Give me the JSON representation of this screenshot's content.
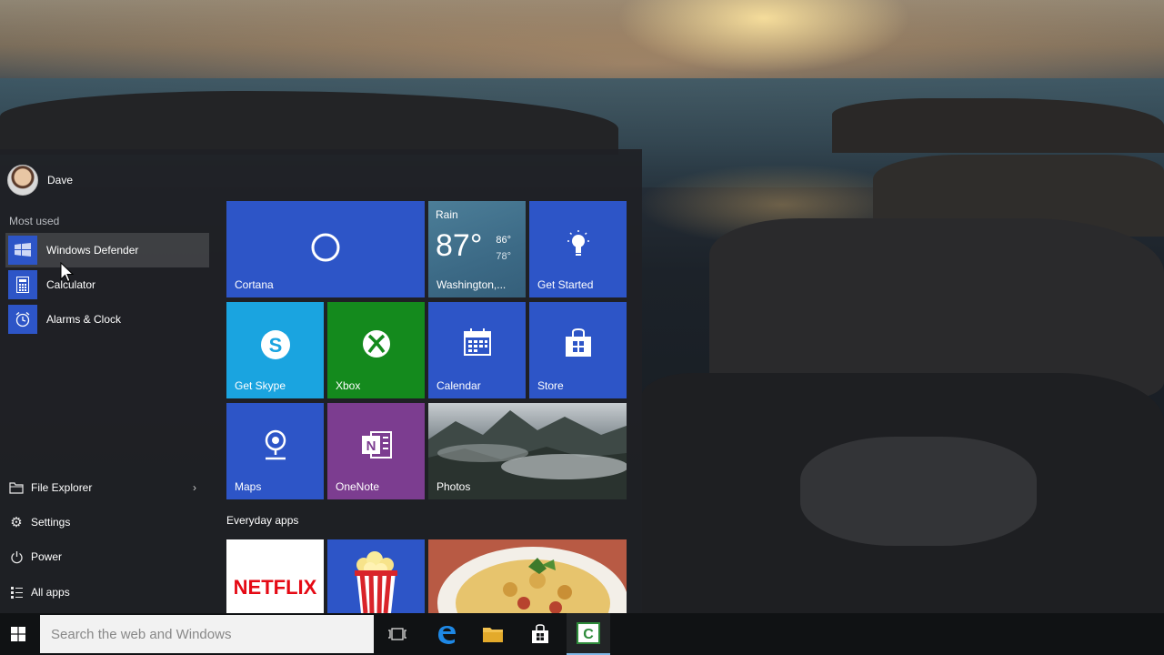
{
  "user": {
    "name": "Dave"
  },
  "most_used": {
    "label": "Most used",
    "items": [
      {
        "label": "Windows Defender",
        "icon": "windows-defender-icon"
      },
      {
        "label": "Calculator",
        "icon": "calculator-icon"
      },
      {
        "label": "Alarms & Clock",
        "icon": "alarm-clock-icon"
      }
    ]
  },
  "system_items": [
    {
      "label": "File Explorer",
      "icon": "folder-icon",
      "has_chevron": true
    },
    {
      "label": "Settings",
      "icon": "gear-icon"
    },
    {
      "label": "Power",
      "icon": "power-icon"
    },
    {
      "label": "All apps",
      "icon": "list-icon"
    }
  ],
  "tiles": {
    "cortana": {
      "label": "Cortana"
    },
    "weather": {
      "condition": "Rain",
      "temp": "87°",
      "high": "86°",
      "low": "78°",
      "label": "Washington,..."
    },
    "get_started": {
      "label": "Get Started"
    },
    "skype": {
      "label": "Get Skype"
    },
    "xbox": {
      "label": "Xbox"
    },
    "calendar": {
      "label": "Calendar"
    },
    "store": {
      "label": "Store"
    },
    "maps": {
      "label": "Maps"
    },
    "onenote": {
      "label": "OneNote"
    },
    "photos": {
      "label": "Photos"
    }
  },
  "everyday_apps": {
    "label": "Everyday apps",
    "netflix": {
      "label": "NETFLIX"
    }
  },
  "taskbar": {
    "search_placeholder": "Search the web and Windows"
  },
  "colors": {
    "tile_blue": "#2d55c7",
    "tile_cyan": "#1aa4e0",
    "tile_green": "#148a1d",
    "tile_purple": "#7c3d90",
    "netflix_red": "#e50914"
  }
}
